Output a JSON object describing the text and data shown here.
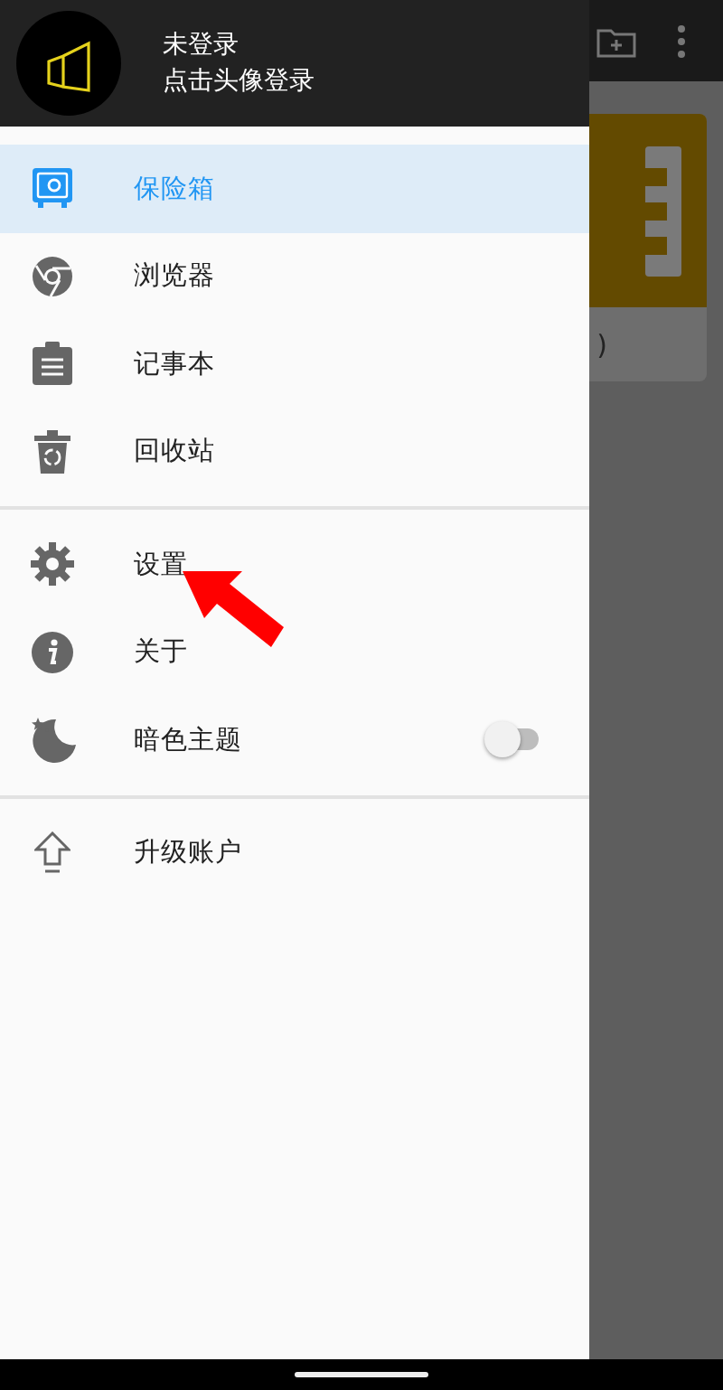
{
  "background": {
    "card_caption": ")"
  },
  "drawer": {
    "header": {
      "title": "未登录",
      "subtitle": "点击头像登录"
    },
    "sections": [
      {
        "items": [
          {
            "label": "保险箱",
            "kind": "link",
            "selected": true
          },
          {
            "label": "浏览器",
            "kind": "link",
            "selected": false
          },
          {
            "label": "记事本",
            "kind": "link",
            "selected": false
          },
          {
            "label": "回收站",
            "kind": "link",
            "selected": false
          }
        ]
      },
      {
        "items": [
          {
            "label": "设置",
            "kind": "link",
            "selected": false
          },
          {
            "label": "关于",
            "kind": "link",
            "selected": false
          },
          {
            "label": "暗色主题",
            "kind": "toggle",
            "selected": false,
            "on": false
          }
        ]
      },
      {
        "items": [
          {
            "label": "升级账户",
            "kind": "link",
            "selected": false
          }
        ]
      }
    ]
  }
}
